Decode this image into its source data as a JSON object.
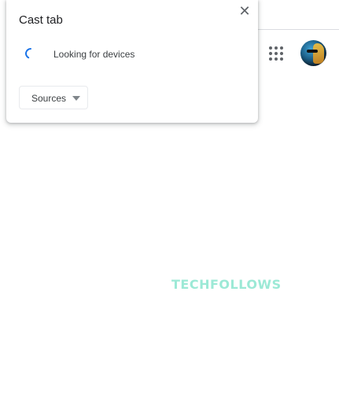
{
  "cast_dialog": {
    "title": "Cast tab",
    "close_glyph": "✕",
    "status_text": "Looking for devices",
    "sources_label": "Sources",
    "spinner_icon": "loading-spinner-icon",
    "spinner_color": "#1a73e8"
  },
  "toolbar": {
    "apps_icon": "apps-grid-icon",
    "avatar_icon": "user-avatar"
  },
  "watermark": {
    "text": "TECHFOLLOWS",
    "color": "#9ce9d6"
  }
}
